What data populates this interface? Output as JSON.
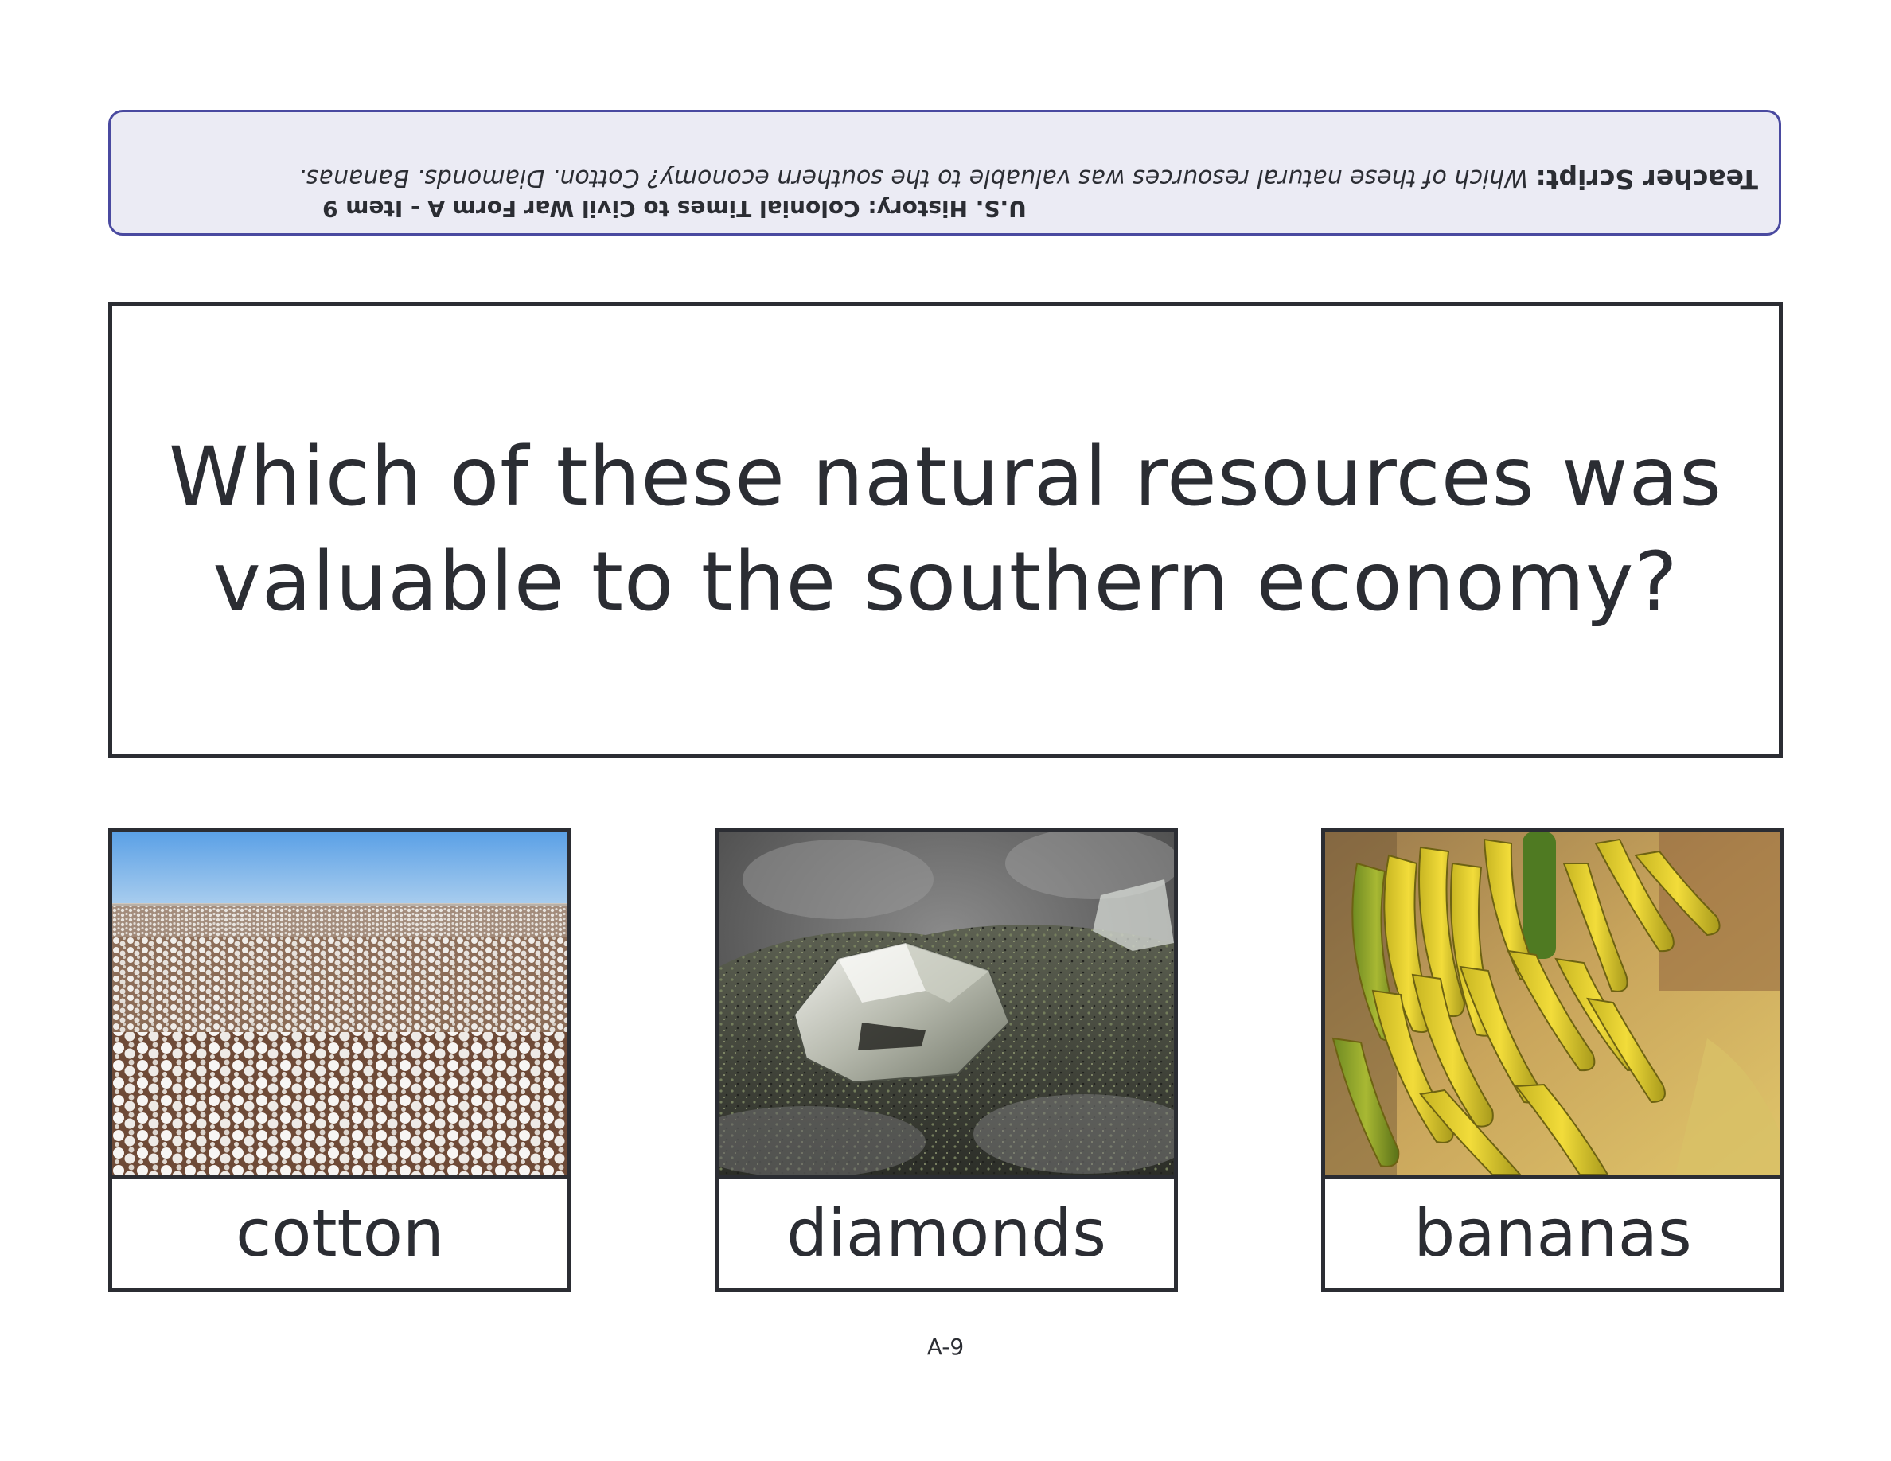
{
  "teacher_banner": {
    "script_label": "Teacher Script:",
    "script_text": "Which of these natural resources was valuable to the southern economy? Cotton. Diamonds. Bananas.",
    "meta": "U.S. History: Colonial Times to Civil War Form A - Item 9",
    "orientation": "upside-down"
  },
  "question": {
    "text": "Which of these natural resources was valuable to the southern economy?"
  },
  "answers": [
    {
      "label": "cotton",
      "image": "cotton-field-photo"
    },
    {
      "label": "diamonds",
      "image": "rough-diamond-photo"
    },
    {
      "label": "bananas",
      "image": "banana-bunch-photo"
    }
  ],
  "footer": {
    "page_number": "A-9"
  },
  "colors": {
    "banner_border": "#4a4aa0",
    "banner_fill": "#ebebf4",
    "text": "#2b2d33",
    "border": "#2b2d33"
  }
}
